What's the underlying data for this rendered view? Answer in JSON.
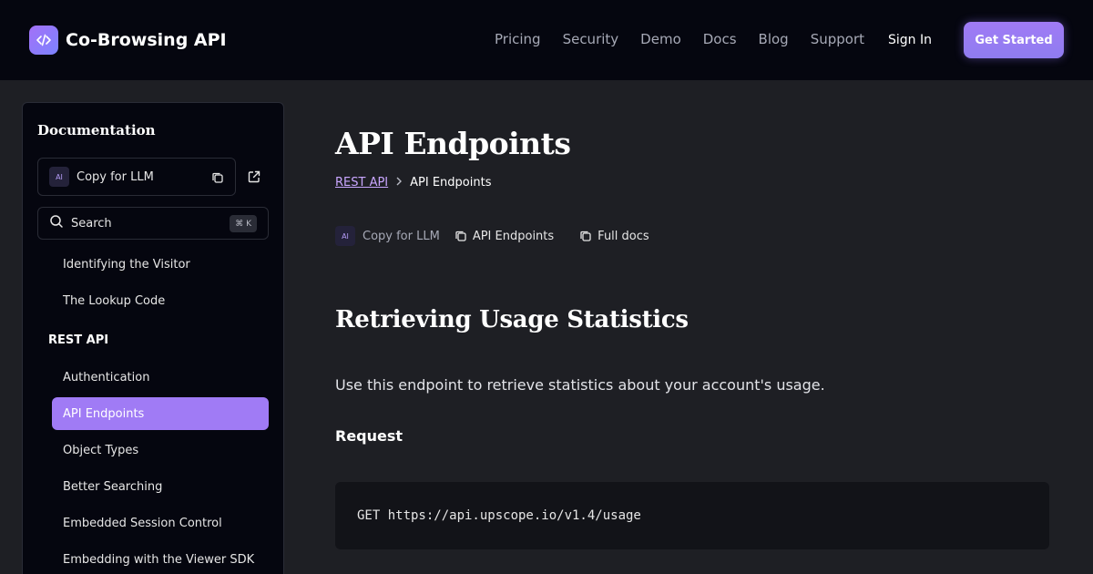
{
  "brand": {
    "name": "Co-Browsing API",
    "logo_icon": "code-icon",
    "accent": "#a07bf5"
  },
  "nav": {
    "links": [
      "Pricing",
      "Security",
      "Demo",
      "Docs",
      "Blog",
      "Support"
    ],
    "sign_in": "Sign In",
    "get_started": "Get Started"
  },
  "sidebar": {
    "title": "Documentation",
    "copy_llm": {
      "badge": "AI",
      "label": "Copy for LLM"
    },
    "search": {
      "label": "Search",
      "shortcut": "⌘ K"
    },
    "items_top": [
      "Identifying the Visitor",
      "The Lookup Code"
    ],
    "section": "REST API",
    "items": [
      "Authentication",
      "API Endpoints",
      "Object Types",
      "Better Searching",
      "Embedded Session Control",
      "Embedding with the Viewer SDK"
    ],
    "active": "API Endpoints"
  },
  "main": {
    "title": "API Endpoints",
    "breadcrumb": {
      "parent": "REST API",
      "current": "API Endpoints"
    },
    "actions": {
      "badge": "AI",
      "copy_llm": "Copy for LLM",
      "page_copy": "API Endpoints",
      "full_docs": "Full docs"
    },
    "section_title": "Retrieving Usage Statistics",
    "description": "Use this endpoint to retrieve statistics about your account's usage.",
    "request_heading": "Request",
    "code": "GET https://api.upscope.io/v1.4/usage"
  }
}
